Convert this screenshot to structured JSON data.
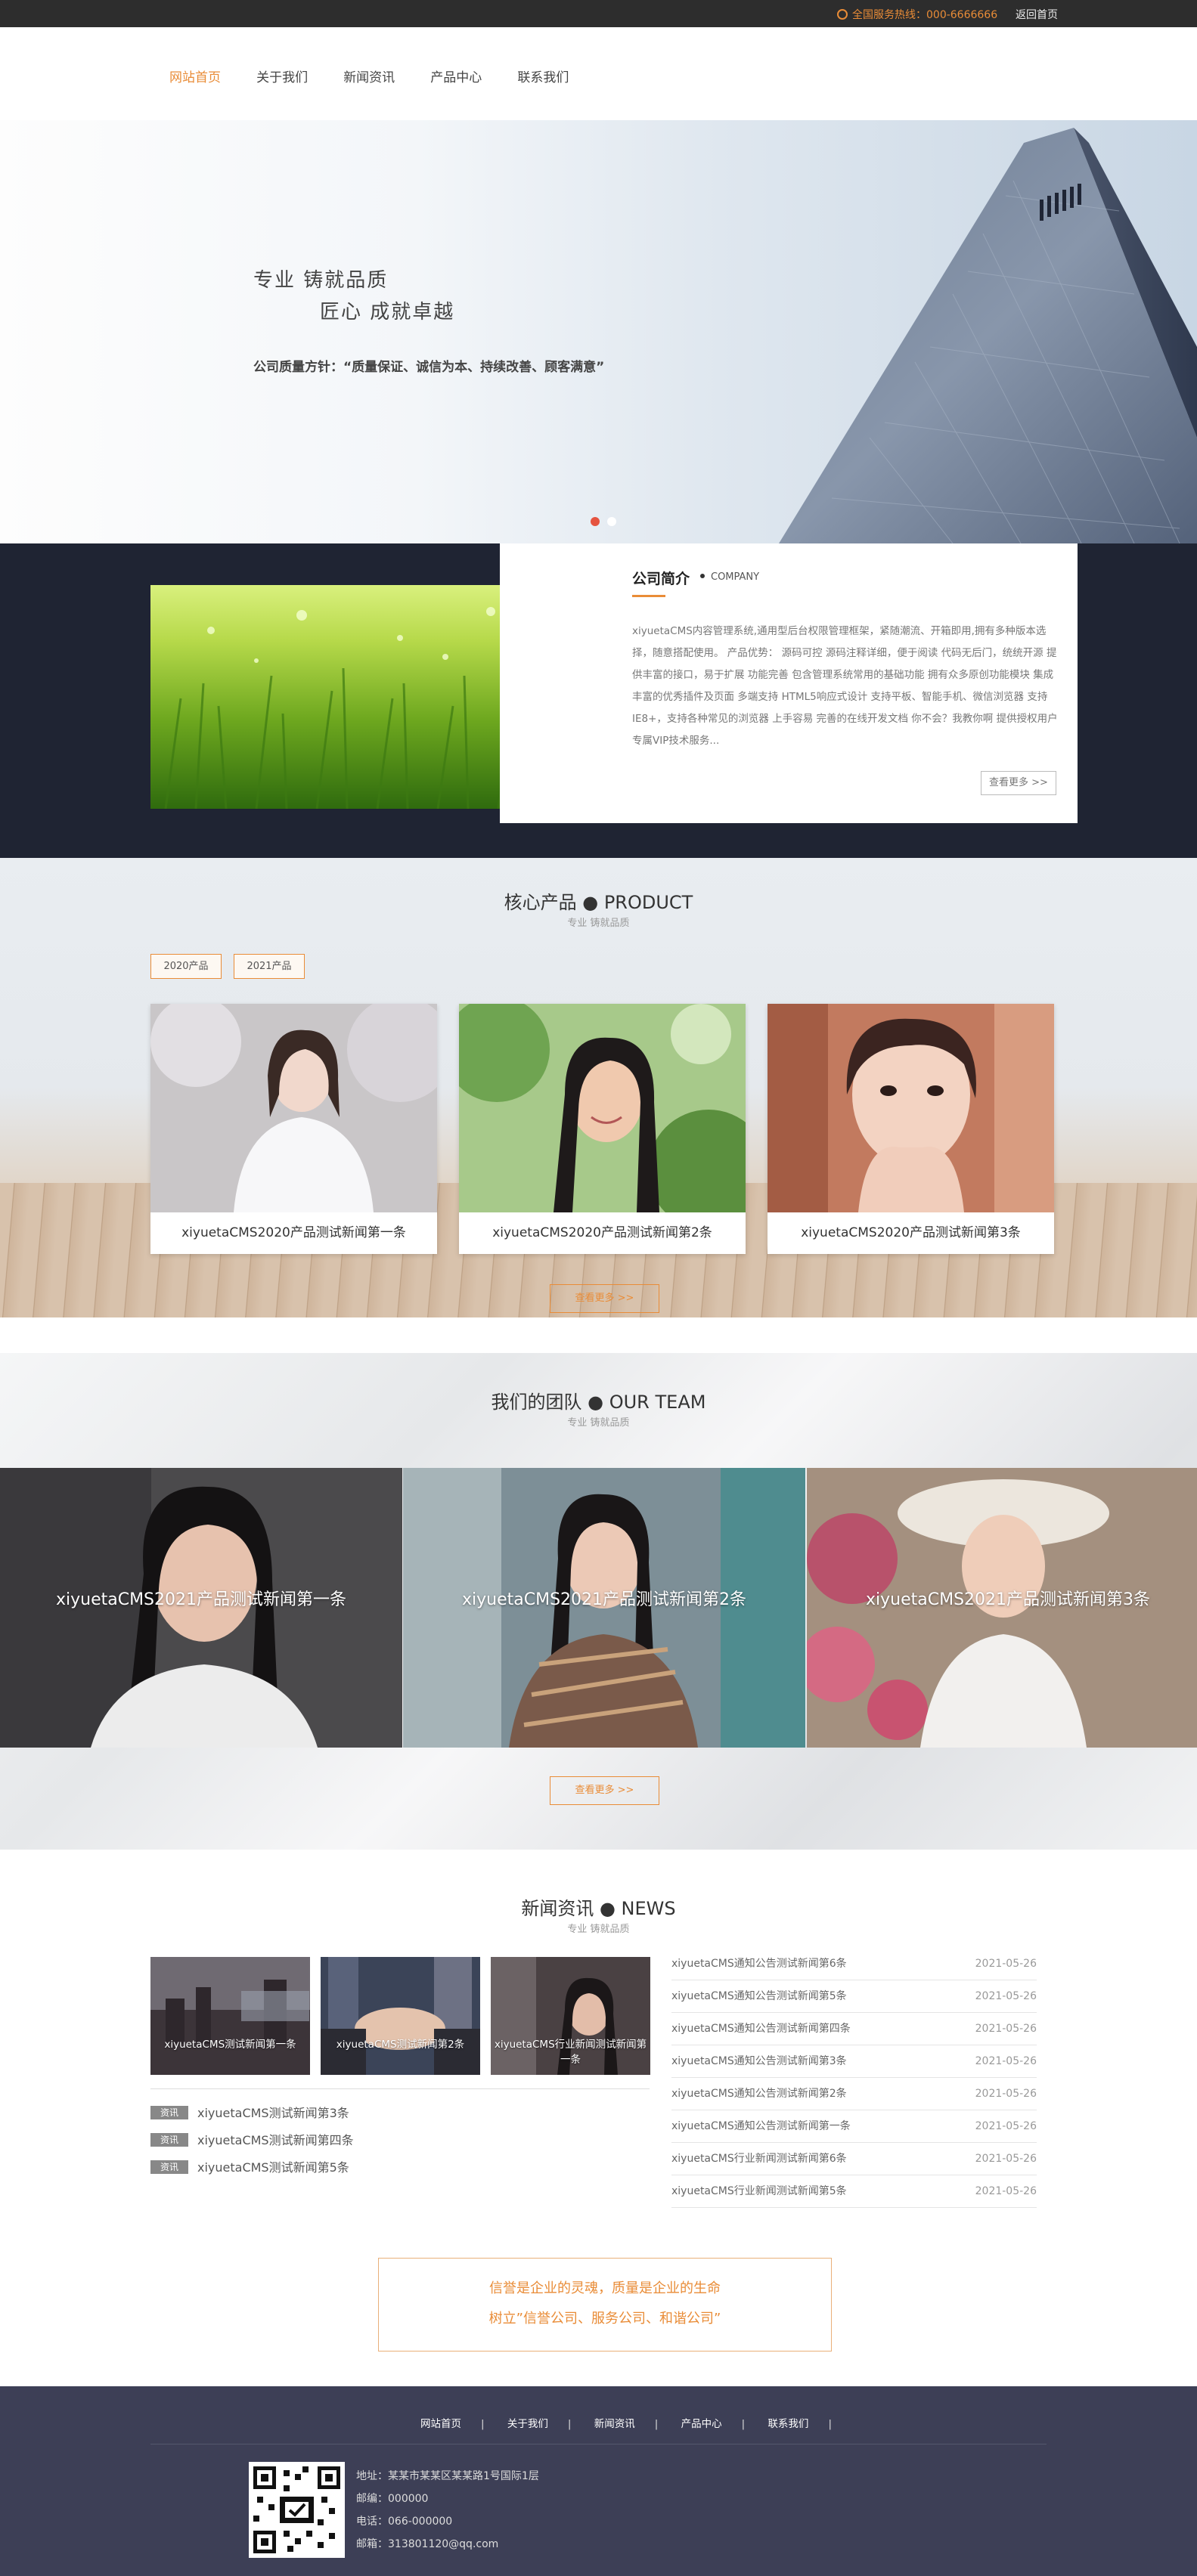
{
  "topbar": {
    "hotline": "全国服务热线：000-6666666",
    "home_link": "返回首页"
  },
  "nav": {
    "items": [
      "网站首页",
      "关于我们",
      "新闻资讯",
      "产品中心",
      "联系我们"
    ],
    "active": "网站首页"
  },
  "banner": {
    "slogan_line1": "专业  铸就品质",
    "slogan_line2": "匠心  成就卓越",
    "policy": "公司质量方针：“质量保证、诚信为本、持续改善、顾客满意”",
    "active_dot": 1,
    "dot_count": 2
  },
  "about": {
    "title": "公司简介",
    "subtitle_en": "COMPANY",
    "description": "xiyuetaCMS内容管理系统,通用型后台权限管理框架，紧随潮流、开箱即用,拥有多种版本选择，随意搭配使用。 产品优势： 源码可控 源码注释详细，便于阅读 代码无后门，统统开源 提供丰富的接口，易于扩展 功能完善 包含管理系统常用的基础功能 拥有众多原创功能模块 集成丰富的优秀插件及页面 多端支持 HTML5响应式设计 支持平板、智能手机、微信浏览器 支持IE8+，支持各种常见的浏览器 上手容易 完善的在线开发文档 你不会？我教你啊 提供授权用户专属VIP技术服务...",
    "more_label": "查看更多 >>"
  },
  "product": {
    "title": "核心产品 ● PRODUCT",
    "subtitle": "专业 铸就品质",
    "tabs": [
      "2020产品",
      "2021产品"
    ],
    "items": [
      "xiyuetaCMS2020产品测试新闻第一条",
      "xiyuetaCMS2020产品测试新闻第2条",
      "xiyuetaCMS2020产品测试新闻第3条"
    ],
    "more_label": "查看更多 >>"
  },
  "team": {
    "title": "我们的团队 ● OUR TEAM",
    "subtitle": "专业 铸就品质",
    "members": [
      "xiyuetaCMS2021产品测试新闻第一条",
      "xiyuetaCMS2021产品测试新闻第2条",
      "xiyuetaCMS2021产品测试新闻第3条"
    ],
    "more_label": "查看更多 >>"
  },
  "news": {
    "title": "新闻资讯 ● NEWS",
    "subtitle": "专业 铸就品质",
    "featured": [
      "xiyuetaCMS测试新闻第一条",
      "xiyuetaCMS测试新闻第2条",
      "xiyuetaCMS行业新闻测试新闻第一条"
    ],
    "tag": "资讯",
    "list": [
      "xiyuetaCMS测试新闻第3条",
      "xiyuetaCMS测试新闻第四条",
      "xiyuetaCMS测试新闻第5条"
    ],
    "right_list": [
      {
        "title": "xiyuetaCMS通知公告测试新闻第6条",
        "date": "2021-05-26"
      },
      {
        "title": "xiyuetaCMS通知公告测试新闻第5条",
        "date": "2021-05-26"
      },
      {
        "title": "xiyuetaCMS通知公告测试新闻第四条",
        "date": "2021-05-26"
      },
      {
        "title": "xiyuetaCMS通知公告测试新闻第3条",
        "date": "2021-05-26"
      },
      {
        "title": "xiyuetaCMS通知公告测试新闻第2条",
        "date": "2021-05-26"
      },
      {
        "title": "xiyuetaCMS通知公告测试新闻第一条",
        "date": "2021-05-26"
      },
      {
        "title": "xiyuetaCMS行业新闻测试新闻第6条",
        "date": "2021-05-26"
      },
      {
        "title": "xiyuetaCMS行业新闻测试新闻第5条",
        "date": "2021-05-26"
      }
    ]
  },
  "quote": {
    "line1": "信誉是企业的灵魂，质量是企业的生命",
    "line2": "树立”信誉公司、服务公司、和谐公司”"
  },
  "footer": {
    "nav": [
      "网站首页",
      "关于我们",
      "新闻资讯",
      "产品中心",
      "联系我们"
    ],
    "separator": "|",
    "address": "地址：某某市某某区某某路1号国际1层",
    "postcode": "邮编：000000",
    "phone": "电话：066-000000",
    "email": "邮箱：313801120@qq.com"
  },
  "colors": {
    "accent": "#e98c37",
    "dark": "#1f2433",
    "footer": "#3d3f56",
    "dot_active": "#e5533f"
  }
}
